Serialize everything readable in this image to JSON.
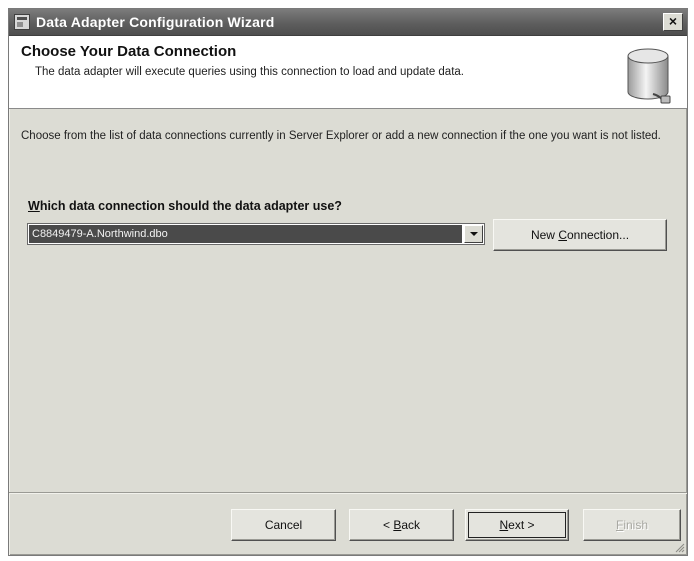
{
  "window": {
    "title": "Data Adapter Configuration Wizard",
    "close_glyph": "×"
  },
  "header": {
    "title": "Choose Your Data Connection",
    "subtitle": "The data adapter will execute queries using this connection to load and update data.",
    "icon": "database-icon"
  },
  "content": {
    "intro": "Choose from the list of data connections currently in Server Explorer or add a new connection if the one you want is not listed.",
    "question_mnemonic": "W",
    "question_rest": "hich data connection should the data adapter use?",
    "connection_value": "C8849479-A.Northwind.dbo",
    "new_connection_pre": "New ",
    "new_connection_mnemonic": "C",
    "new_connection_post": "onnection..."
  },
  "footer": {
    "cancel_label": "Cancel",
    "back_pre": "< ",
    "back_mnemonic": "B",
    "back_post": "ack",
    "next_mnemonic": "N",
    "next_post": "ext >",
    "finish_mnemonic": "F",
    "finish_post": "inish"
  },
  "colors": {
    "dialog_bg": "#dcdcd4",
    "titlebar": "#5e5e5e",
    "selection": "#4a4a4a"
  }
}
